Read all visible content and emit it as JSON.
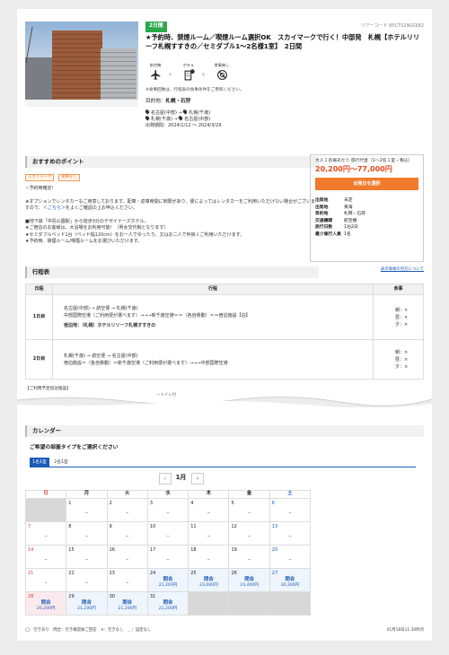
{
  "header": {
    "days_badge": "2日間",
    "tour_code": "ツアーコード B5CTS2NGOJ82",
    "title": "★予約時、禁煙ルーム／喫煙ルーム選択OK　スカイマークで行く！中部発　札幌【ホテルリリーフ札幌すすきの／セミダブル1～2名様1室】　2日間",
    "features": [
      {
        "label": "航空機",
        "icon": "airplane-icon"
      },
      {
        "label": "ホテル",
        "icon": "hotel-icon",
        "badge": "1泊"
      },
      {
        "label": "食事無し",
        "icon": "no-meal-icon"
      }
    ],
    "note": "※食事回数は、行程表の食事条件をご参照ください。",
    "destination_label": "目的地：",
    "destination": "札幌・石狩",
    "routes": [
      {
        "from": "名古屋(中部)",
        "to": "札幌(千歳)"
      },
      {
        "from": "札幌(千歳)",
        "to": "名古屋(中部)"
      }
    ],
    "period": "出発期間：2024/1/12 ～ 2024/3/29"
  },
  "recommend": {
    "heading": "おすすめのポイント",
    "tags": [
      "スカイマーク",
      "食事なし"
    ],
    "lines": [
      "☆予約時確定！",
      "",
      "★オプションでレンタカーもご用意しております。配車・返車時間に制限があり、便によってはレンタカーをご利用いただけない場合がございますので、＜こちら＞をよくご確認の上お申込ください。",
      "",
      "■地下鉄「中島公園駅」から徒歩3分のデザイナーズホテル。",
      "★ご宿泊のお客様は、大浴場をお利用可能！（男女交代制となります）",
      "★セミダブルベッド1台（ベッド幅120cm）をお一人でゆったり、又はお二人で仲良くご利用いただけます。",
      "★予約時、禁煙ルーム/喫煙ルームをお選びいただけます。"
    ],
    "link_text": "＜こちら＞"
  },
  "price_box": {
    "caption": "大人１名様あたり 旅行代金（1～2名１室・税込）",
    "price": "20,200円～77,000円",
    "button": "出発日を選択",
    "rows": [
      {
        "k": "出発地",
        "v": "未定"
      },
      {
        "k": "出発地",
        "v": "東海"
      },
      {
        "k": "目的地",
        "v": "札幌・石狩"
      },
      {
        "k": "交通機関",
        "v": "航空機"
      },
      {
        "k": "旅行日数",
        "v": "1泊2日"
      },
      {
        "k": "最少催行人員",
        "v": "1名"
      }
    ],
    "prices_link": "表示価格の見方について"
  },
  "itinerary": {
    "heading": "行程表",
    "headers": [
      "日程",
      "行程",
      "食事"
    ],
    "days": [
      {
        "day": "1日目",
        "lines": [
          "名古屋(中部) → 航空便 → 札幌(千歳)",
          "中部国際空港（ご利用便が選べます）→→→新千歳空港＝＝（各自移動）＝＝宿泊施設【泊】",
          "",
          "宿泊地：（札幌）ホテルリリーフ札幌すすきの"
        ],
        "meals": [
          "朝：×",
          "昼：×",
          "夕：×"
        ]
      },
      {
        "day": "2日目",
        "lines": [
          "札幌(千歳) → 航空便 → 名古屋(中部)",
          "宿泊施設＝（各自移動）＝新千歳空港（ご利用便が選べます）→→→中部国際空港"
        ],
        "meals": [
          "朝：×",
          "昼：×",
          "夕：×"
        ]
      }
    ],
    "footnote": "【ご利用予定宿泊施設】",
    "torn_text": "ートイレ付"
  },
  "calendar": {
    "heading": "カレンダー",
    "room_question": "ご希望の部屋タイプをご選択ください",
    "room_tabs": [
      "1名1室",
      "2名1室"
    ],
    "month": "1月",
    "weekdays": [
      "日",
      "月",
      "火",
      "水",
      "木",
      "金",
      "土"
    ],
    "weeks": [
      [
        null,
        {
          "d": "1",
          "s": "_"
        },
        {
          "d": "2",
          "s": "_"
        },
        {
          "d": "3",
          "s": "_"
        },
        {
          "d": "4",
          "s": "_"
        },
        {
          "d": "5",
          "s": "_"
        },
        {
          "d": "6",
          "s": "_"
        }
      ],
      [
        {
          "d": "7",
          "s": "_"
        },
        {
          "d": "8",
          "s": "_"
        },
        {
          "d": "9",
          "s": "_"
        },
        {
          "d": "10",
          "s": "_"
        },
        {
          "d": "11",
          "s": "_"
        },
        {
          "d": "12",
          "s": "_"
        },
        {
          "d": "13",
          "s": "_"
        }
      ],
      [
        {
          "d": "14",
          "s": "_"
        },
        {
          "d": "15",
          "s": "_"
        },
        {
          "d": "16",
          "s": "_"
        },
        {
          "d": "17",
          "s": "_"
        },
        {
          "d": "18",
          "s": "_"
        },
        {
          "d": "19",
          "s": "_"
        },
        {
          "d": "20",
          "s": "_"
        }
      ],
      [
        {
          "d": "21",
          "s": "_"
        },
        {
          "d": "22",
          "s": "_"
        },
        {
          "d": "23",
          "s": "_"
        },
        {
          "d": "24",
          "st": "問合",
          "p": "21,200円"
        },
        {
          "d": "25",
          "st": "問合",
          "p": "23,600円"
        },
        {
          "d": "26",
          "st": "問合",
          "p": "24,400円"
        },
        {
          "d": "27",
          "st": "問合",
          "p": "30,300円"
        }
      ],
      [
        {
          "d": "28",
          "st": "問合",
          "p": "20,200円",
          "sel": true
        },
        {
          "d": "29",
          "st": "問合",
          "p": "21,200円"
        },
        {
          "d": "30",
          "st": "問合",
          "p": "21,200円"
        },
        {
          "d": "31",
          "st": "問合",
          "p": "21,200円"
        },
        null,
        null,
        null
      ]
    ],
    "legend": "◯：空きあり　問合：空き確認後ご回答　✕：空きなし　＿：設定なし",
    "updated": "01月18日11:30時点"
  }
}
